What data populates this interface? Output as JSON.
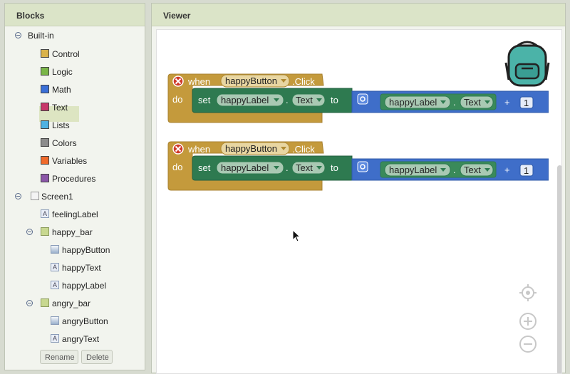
{
  "blocks_panel": {
    "title": "Blocks",
    "builtin": {
      "label": "Built-in",
      "items": [
        {
          "label": "Control",
          "color": "#d9b24a"
        },
        {
          "label": "Logic",
          "color": "#7ab648"
        },
        {
          "label": "Math",
          "color": "#3a6fd8"
        },
        {
          "label": "Text",
          "color": "#c7386a"
        },
        {
          "label": "Lists",
          "color": "#4fb2e3"
        },
        {
          "label": "Colors",
          "color": "#8c8c8c"
        },
        {
          "label": "Variables",
          "color": "#f06a2b"
        },
        {
          "label": "Procedures",
          "color": "#8b56a8"
        }
      ]
    },
    "screen": {
      "label": "Screen1",
      "feeling_label": "feelingLabel",
      "happy_bar": {
        "label": "happy_bar",
        "children": [
          "happyButton",
          "happyText",
          "happyLabel"
        ]
      },
      "angry_bar": {
        "label": "angry_bar",
        "children": [
          "angryButton",
          "angryText"
        ]
      }
    },
    "rename_label": "Rename",
    "delete_label": "Delete"
  },
  "viewer": {
    "title": "Viewer",
    "blocks": [
      {
        "when": "when",
        "component": "happyButton",
        "event": ".Click",
        "do": "do",
        "set": "set",
        "target_component": "happyLabel",
        "dot": ".",
        "property": "Text",
        "to": "to",
        "operand_component": "happyLabel",
        "operand_property": "Text",
        "op": "+",
        "number": "1"
      },
      {
        "when": "when",
        "component": "happyButton",
        "event": ".Click",
        "do": "do",
        "set": "set",
        "target_component": "happyLabel",
        "dot": ".",
        "property": "Text",
        "to": "to",
        "operand_component": "happyLabel",
        "operand_property": "Text",
        "op": "+",
        "number": "1"
      }
    ]
  },
  "colors": {
    "event_block": "#c49a3c",
    "setter_block": "#2e7a50",
    "math_block": "#3f6ec9",
    "getter_block": "#3a8a5a",
    "error_icon": "#d03a2a"
  }
}
